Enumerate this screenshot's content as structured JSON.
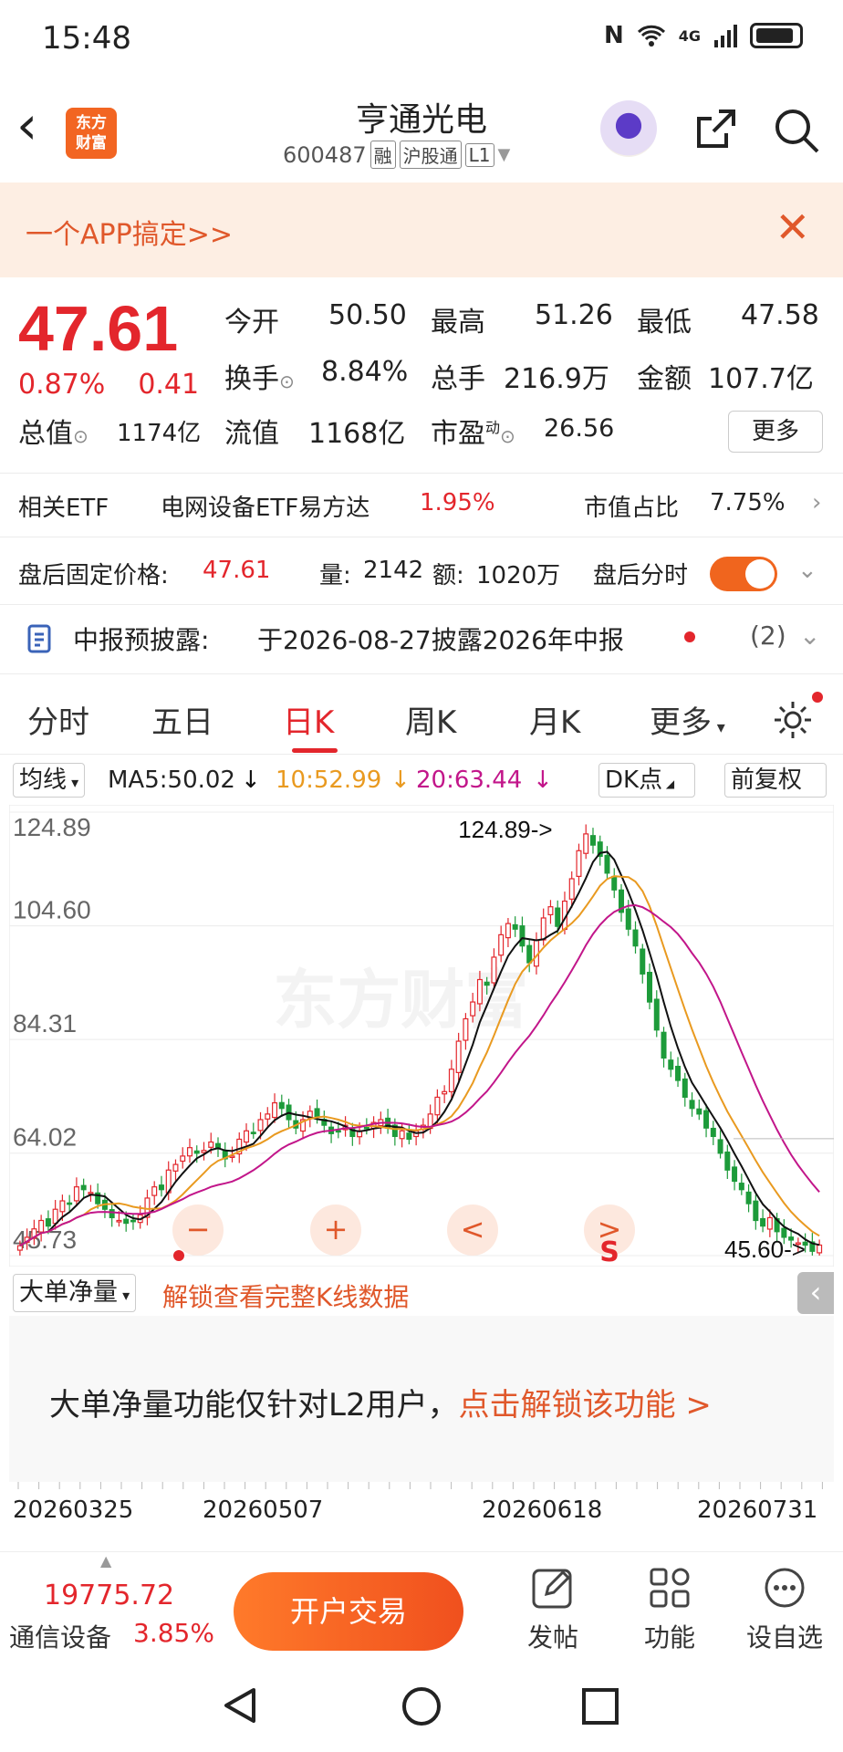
{
  "status": {
    "time": "15:48",
    "network": "4G"
  },
  "header": {
    "title": "亨通光电",
    "code": "600487",
    "tags": [
      "融",
      "沪股通",
      "L1"
    ],
    "logo_line1": "东方",
    "logo_line2": "财富"
  },
  "banner": {
    "text": "一个APP搞定>>"
  },
  "quote": {
    "price": "47.61",
    "change_pct": "0.87%",
    "change": "0.41",
    "open_label": "今开",
    "open": "50.50",
    "high_label": "最高",
    "high": "51.26",
    "low_label": "最低",
    "low": "47.58",
    "turnover_label": "换手",
    "turnover": "8.84%",
    "volume_label": "总手",
    "volume": "216.9万",
    "amount_label": "金额",
    "amount": "107.7亿",
    "mktcap_label": "总值",
    "mktcap": "1174亿",
    "float_label": "流值",
    "float_cap": "1168亿",
    "pe_label": "市盈",
    "pe_sup": "动",
    "pe": "26.56",
    "more_label": "更多"
  },
  "etf": {
    "label": "相关ETF",
    "name": "电网设备ETF易方达",
    "pct": "1.95%",
    "ratio_label": "市值占比",
    "ratio": "7.75%"
  },
  "after_hours": {
    "price_label": "盘后固定价格:",
    "price": "47.61",
    "vol_label": "量:",
    "vol": "2142",
    "amt_label": "额:",
    "amt": "1020万",
    "timeshare_label": "盘后分时",
    "toggle_on": true
  },
  "disclosure": {
    "label": "中报预披露:",
    "text": "于2026-08-27披露2026年中报",
    "count": "(2)"
  },
  "tabs": [
    {
      "label": "分时",
      "active": false
    },
    {
      "label": "五日",
      "active": false
    },
    {
      "label": "日K",
      "active": true
    },
    {
      "label": "周K",
      "active": false
    },
    {
      "label": "月K",
      "active": false
    },
    {
      "label": "更多",
      "active": false
    }
  ],
  "indicator": {
    "ma_select": "均线",
    "ma5": "MA5:50.02",
    "ma10": "10:52.99",
    "ma20": "20:63.44",
    "dk": "DK点",
    "adjust": "前复权",
    "ma5_color": "#111111",
    "ma10_color": "#e99a20",
    "ma20_color": "#c2168a"
  },
  "chart_data": {
    "type": "candlestick",
    "y_ticks": [
      "124.89",
      "104.60",
      "84.31",
      "64.02",
      "45.73"
    ],
    "ylim": [
      45.73,
      124.89
    ],
    "high_marker": "124.89->",
    "low_marker": "45.60->",
    "watermark": "东方财富",
    "x_ticks": [
      "20260325",
      "20260507",
      "20260618",
      "20260731"
    ],
    "closes": [
      47.5,
      49,
      50.5,
      52,
      51,
      54,
      55.5,
      55,
      58,
      57.5,
      57,
      55,
      54,
      52.5,
      52,
      51.5,
      52,
      53,
      56,
      58,
      57.5,
      61,
      62,
      63.5,
      65,
      64,
      64.5,
      66,
      65,
      63,
      63.5,
      66.5,
      68,
      67.5,
      70,
      71,
      73,
      72,
      70,
      68.5,
      70,
      71.5,
      70.5,
      69,
      67.5,
      68,
      69,
      67,
      68,
      68.5,
      69.5,
      70,
      68.5,
      67,
      68,
      66.5,
      68,
      69,
      71,
      74,
      75,
      79,
      84,
      88,
      91,
      95,
      94,
      99,
      103,
      105,
      104,
      101,
      98,
      102,
      106,
      108,
      104.5,
      109,
      113,
      118,
      121,
      119,
      117,
      114,
      111,
      107,
      104,
      101,
      96,
      91,
      86,
      81,
      79,
      77,
      74,
      72,
      71,
      68.5,
      67,
      64,
      61,
      59,
      57.5,
      55,
      52,
      51,
      52.5,
      50,
      49,
      48.5,
      48,
      47.6,
      46.5,
      47.61
    ],
    "ma5_value": 50.02,
    "ma10_value": 52.99,
    "ma20_value": 63.44
  },
  "chart_controls": [
    "−",
    "+",
    "<",
    ">",
    "S"
  ],
  "fund_flow": {
    "select": "大单净量",
    "unlock_text": "解锁查看完整K线数据",
    "message": "大单净量功能仅针对L2用户，",
    "action": "点击解锁该功能 >"
  },
  "bottom": {
    "index_value": "19775.72",
    "index_name": "通信设备",
    "index_pct": "3.85%",
    "trade_label": "开户交易",
    "post_label": "发帖",
    "func_label": "功能",
    "watch_label": "设自选"
  }
}
